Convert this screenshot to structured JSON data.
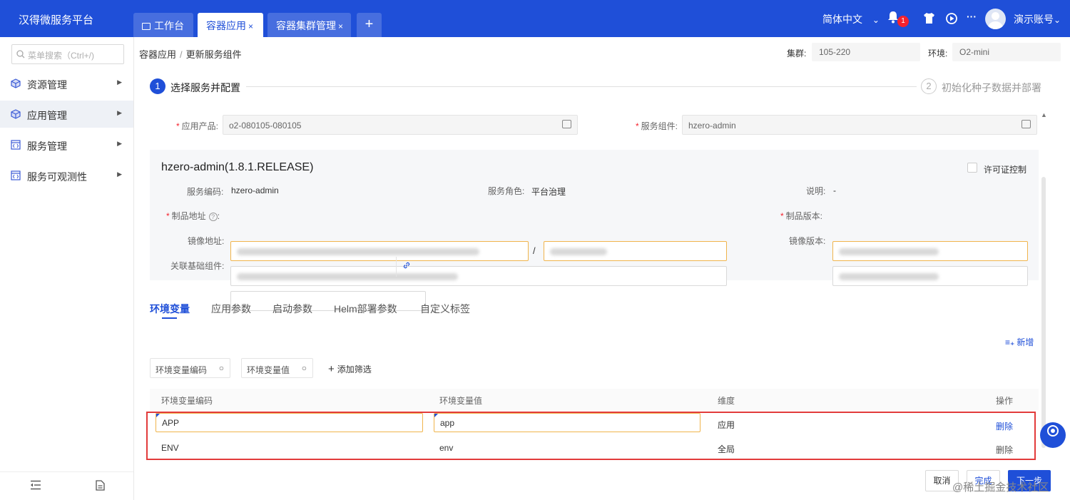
{
  "app": {
    "title": "汉得微服务平台"
  },
  "tabs": [
    {
      "label": "工作台",
      "icon": "monitor-icon"
    },
    {
      "label": "容器应用",
      "close": "×"
    },
    {
      "label": "容器集群管理",
      "close": "×"
    }
  ],
  "tab_add": "+",
  "header": {
    "language": "简体中文",
    "lang_caret": "⌄",
    "notif_count": "1",
    "account": "演示账号",
    "account_caret": "⌄",
    "more": "···"
  },
  "sidebar": {
    "search_placeholder": "菜单搜索（Ctrl+/)",
    "items": [
      {
        "label": "资源管理"
      },
      {
        "label": "应用管理"
      },
      {
        "label": "服务管理"
      },
      {
        "label": "服务可观测性"
      }
    ]
  },
  "breadcrumb": {
    "parent": "容器应用",
    "separator": "/",
    "current": "更新服务组件"
  },
  "cluster": {
    "label": "集群:",
    "value": "105-220"
  },
  "environment": {
    "label": "环境:",
    "value": "O2-mini"
  },
  "steps": [
    {
      "num": "1",
      "label": "选择服务并配置"
    },
    {
      "num": "2",
      "label": "初始化种子数据并部署"
    }
  ],
  "form": {
    "product_label": "应用产品:",
    "product_value": "o2-080105-080105",
    "component_label": "服务组件:",
    "component_value": "hzero-admin"
  },
  "service": {
    "title": "hzero-admin(1.8.1.RELEASE)",
    "license_label": "许可证控制",
    "code_label": "服务编码:",
    "code_value": "hzero-admin",
    "role_label": "服务角色:",
    "role_value": "平台治理",
    "desc_label": "说明:",
    "desc_value": "-",
    "artifact_addr_label": "制品地址",
    "artifact_addr_help": "?",
    "artifact_ver_label": "制品版本:",
    "image_addr_label": "镜像地址:",
    "image_ver_label": "镜像版本:",
    "related_label": "关联基础组件:",
    "slash": "/"
  },
  "config_tabs": [
    {
      "label": "环境变量"
    },
    {
      "label": "应用参数"
    },
    {
      "label": "启动参数"
    },
    {
      "label": "Helm部署参数"
    },
    {
      "label": "自定义标签"
    }
  ],
  "add_new": "新增",
  "filters": {
    "code": "环境变量编码",
    "value": "环境变量值",
    "add": "添加筛选"
  },
  "table": {
    "columns": [
      "环境变量编码",
      "环境变量值",
      "维度",
      "操作"
    ],
    "rows": [
      {
        "code": "APP",
        "value": "app",
        "dimension": "应用",
        "action": "删除"
      },
      {
        "code": "ENV",
        "value": "env",
        "dimension": "全局",
        "action": "删除"
      }
    ]
  },
  "buttons": {
    "cancel": "取消",
    "finish": "完成",
    "next": "下一步"
  },
  "watermark": "@稀土掘金技术社区",
  "colors": {
    "primary": "#1f4fd8",
    "highlight_border": "#e23b3b",
    "warn_border": "#f0b44c"
  }
}
